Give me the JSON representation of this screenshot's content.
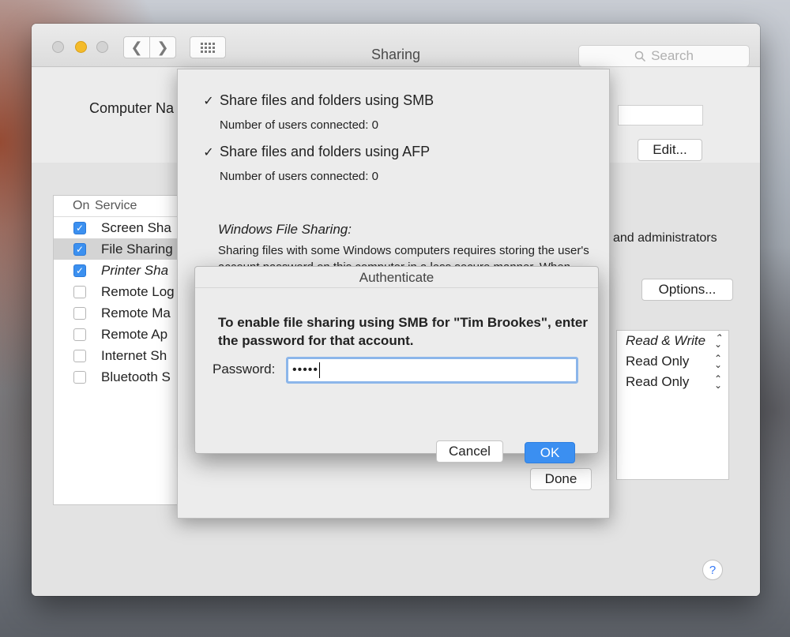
{
  "window": {
    "title": "Sharing",
    "search_placeholder": "Search"
  },
  "main": {
    "computer_name_label": "Computer Na",
    "edit_label": "Edit...",
    "options_label": "Options...",
    "admins_text": "and administrators",
    "help_label": "?"
  },
  "services": {
    "col_on": "On",
    "col_service": "Service",
    "rows": [
      {
        "label": "Screen Sha",
        "on": true
      },
      {
        "label": "File Sharing",
        "on": true,
        "selected": true
      },
      {
        "label": "Printer Sha",
        "on": true
      },
      {
        "label": "Remote Log",
        "on": false
      },
      {
        "label": "Remote Ma",
        "on": false
      },
      {
        "label": "Remote Ap",
        "on": false
      },
      {
        "label": "Internet Sh",
        "on": false
      },
      {
        "label": "Bluetooth S",
        "on": false
      }
    ]
  },
  "permissions": [
    {
      "value": "Read & Write"
    },
    {
      "value": "Read Only"
    },
    {
      "value": "Read Only"
    }
  ],
  "sheet": {
    "smb_label": "Share files and folders using SMB",
    "smb_users": "Number of users connected: 0",
    "afp_label": "Share files and folders using AFP",
    "afp_users": "Number of users connected: 0",
    "wfs_title": "Windows File Sharing:",
    "wfs_body": "Sharing files with some Windows computers requires storing the user's account password on this computer in a less secure manner.  When you enable Windows sharing for a user account,",
    "done_label": "Done"
  },
  "auth": {
    "title": "Authenticate",
    "message": "To enable file sharing using SMB for \"Tim Brookes\", enter the password for that account.",
    "password_label": "Password:",
    "password_value": "•••••",
    "cancel_label": "Cancel",
    "ok_label": "OK"
  }
}
